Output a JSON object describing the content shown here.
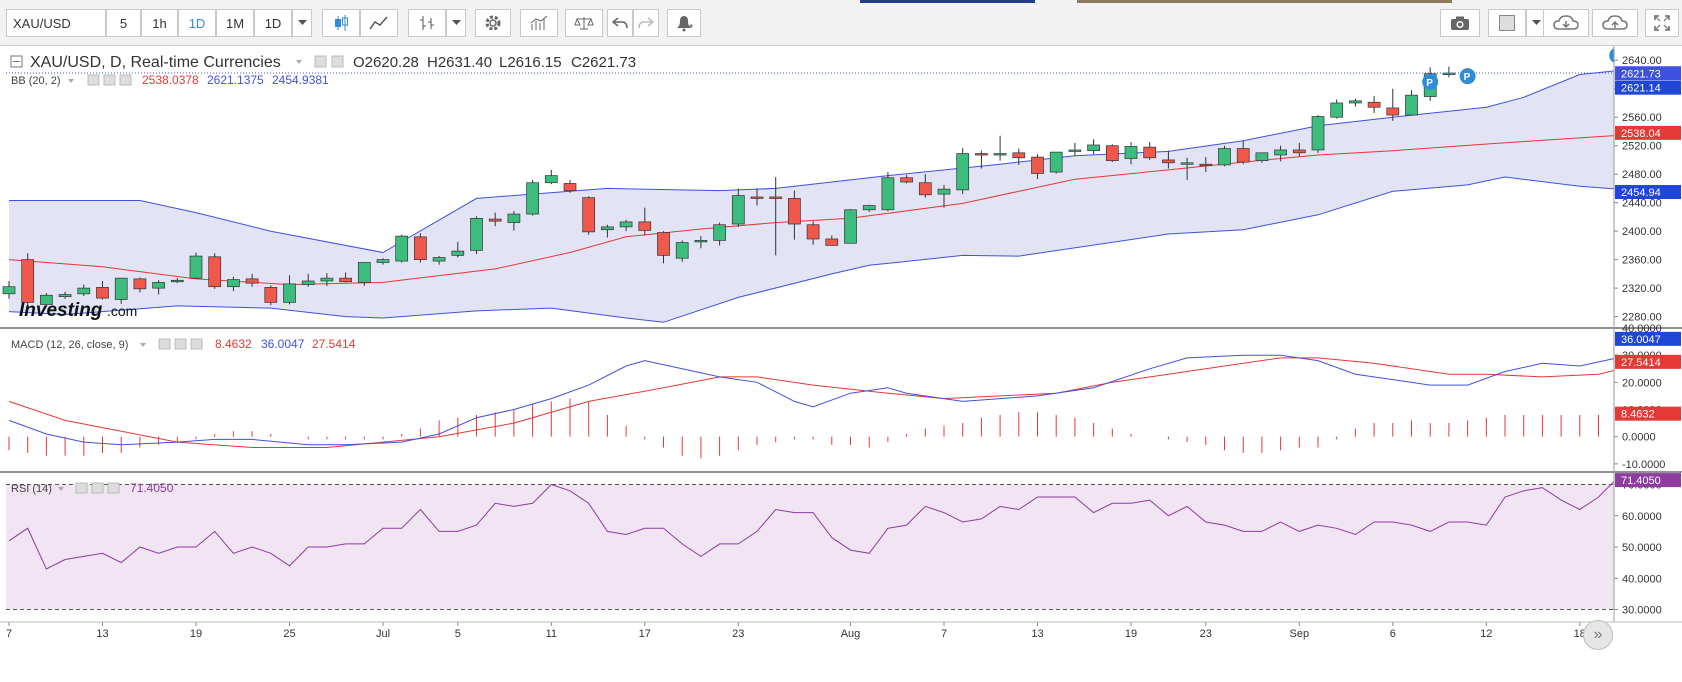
{
  "toolbar": {
    "symbol": "XAU/USD",
    "intervals": [
      "5",
      "1h",
      "1D",
      "1M",
      "1D"
    ],
    "active_interval_index": 2
  },
  "colors": {
    "up": "#3dbd7d",
    "down": "#f0584b",
    "bb_band": "#3f51e0",
    "bb_basis": "#e53935",
    "band_fill": "#e2e3f4",
    "macd_line": "#3f51e0",
    "signal_line": "#e53935",
    "hist": "#e53935",
    "rsi_line": "#8e3ca0",
    "rsi_fill": "#f1e4f3"
  },
  "chart_data": {
    "type": "candlestick",
    "title": "XAU/USD, D, Real-time Currencies",
    "ohlc_labels": {
      "open": "O2620.28",
      "high": "H2631.40",
      "low": "L2616.15",
      "close": "C2621.73"
    },
    "price_axis": {
      "ticks": [
        "2640.00",
        "2600.00",
        "2560.00",
        "2520.00",
        "2480.00",
        "2440.00",
        "2400.00",
        "2360.00",
        "2320.00",
        "2280.00"
      ],
      "ylim": [
        2264,
        2660
      ]
    },
    "price_tags": {
      "last": "2621.73",
      "bb_upper": "2621.14",
      "bb_basis": "2538.04",
      "bb_lower": "2454.94"
    },
    "time_axis": {
      "labels": [
        "7",
        "13",
        "19",
        "25",
        "Jul",
        "5",
        "11",
        "17",
        "23",
        "Aug",
        "7",
        "13",
        "19",
        "23",
        "Sep",
        "6",
        "12",
        "18"
      ],
      "label_bar_index": [
        0,
        5,
        10,
        15,
        20,
        24,
        29,
        34,
        39,
        45,
        50,
        55,
        60,
        64,
        69,
        74,
        79,
        84
      ]
    },
    "candles": [
      [
        2312,
        2330,
        2305,
        2322
      ],
      [
        2360,
        2369,
        2294,
        2300
      ],
      [
        2297,
        2313,
        2295,
        2310
      ],
      [
        2308,
        2315,
        2305,
        2311
      ],
      [
        2312,
        2325,
        2309,
        2320
      ],
      [
        2321,
        2330,
        2304,
        2306
      ],
      [
        2304,
        2332,
        2298,
        2334
      ],
      [
        2333,
        2335,
        2314,
        2319
      ],
      [
        2320,
        2331,
        2311,
        2328
      ],
      [
        2329,
        2334,
        2327,
        2331
      ],
      [
        2334,
        2370,
        2334,
        2365
      ],
      [
        2364,
        2369,
        2319,
        2322
      ],
      [
        2322,
        2336,
        2316,
        2332
      ],
      [
        2333,
        2340,
        2322,
        2327
      ],
      [
        2321,
        2324,
        2296,
        2300
      ],
      [
        2300,
        2338,
        2297,
        2326
      ],
      [
        2325,
        2340,
        2322,
        2330
      ],
      [
        2330,
        2341,
        2323,
        2334
      ],
      [
        2334,
        2342,
        2328,
        2329
      ],
      [
        2328,
        2356,
        2323,
        2356
      ],
      [
        2356,
        2362,
        2353,
        2360
      ],
      [
        2358,
        2395,
        2356,
        2393
      ],
      [
        2392,
        2397,
        2356,
        2360
      ],
      [
        2358,
        2365,
        2353,
        2363
      ],
      [
        2366,
        2385,
        2363,
        2372
      ],
      [
        2373,
        2421,
        2368,
        2418
      ],
      [
        2417,
        2426,
        2407,
        2414
      ],
      [
        2412,
        2428,
        2401,
        2424
      ],
      [
        2424,
        2472,
        2422,
        2468
      ],
      [
        2468,
        2486,
        2466,
        2478
      ],
      [
        2467,
        2472,
        2454,
        2457
      ],
      [
        2447,
        2449,
        2395,
        2399
      ],
      [
        2402,
        2409,
        2391,
        2406
      ],
      [
        2406,
        2416,
        2400,
        2413
      ],
      [
        2413,
        2433,
        2394,
        2401
      ],
      [
        2398,
        2400,
        2355,
        2366
      ],
      [
        2362,
        2387,
        2357,
        2384
      ],
      [
        2385,
        2393,
        2376,
        2387
      ],
      [
        2387,
        2412,
        2380,
        2409
      ],
      [
        2410,
        2460,
        2406,
        2450
      ],
      [
        2448,
        2460,
        2436,
        2446
      ],
      [
        2448,
        2476,
        2366,
        2446
      ],
      [
        2446,
        2457,
        2388,
        2410
      ],
      [
        2409,
        2414,
        2381,
        2389
      ],
      [
        2389,
        2394,
        2380,
        2380
      ],
      [
        2383,
        2431,
        2383,
        2430
      ],
      [
        2430,
        2437,
        2427,
        2436
      ],
      [
        2430,
        2483,
        2428,
        2475
      ],
      [
        2475,
        2479,
        2467,
        2469
      ],
      [
        2468,
        2480,
        2447,
        2451
      ],
      [
        2452,
        2465,
        2433,
        2459
      ],
      [
        2458,
        2517,
        2452,
        2509
      ],
      [
        2509,
        2513,
        2488,
        2507
      ],
      [
        2507,
        2534,
        2499,
        2509
      ],
      [
        2510,
        2516,
        2493,
        2503
      ],
      [
        2504,
        2508,
        2473,
        2481
      ],
      [
        2483,
        2511,
        2481,
        2511
      ],
      [
        2512,
        2524,
        2506,
        2514
      ],
      [
        2513,
        2529,
        2508,
        2521
      ],
      [
        2520,
        2522,
        2497,
        2499
      ],
      [
        2502,
        2525,
        2494,
        2519
      ],
      [
        2518,
        2525,
        2500,
        2503
      ],
      [
        2500,
        2513,
        2488,
        2496
      ],
      [
        2495,
        2503,
        2472,
        2496
      ],
      [
        2494,
        2504,
        2483,
        2492
      ],
      [
        2493,
        2520,
        2491,
        2516
      ],
      [
        2516,
        2527,
        2494,
        2497
      ],
      [
        2499,
        2510,
        2496,
        2510
      ],
      [
        2507,
        2520,
        2498,
        2514
      ],
      [
        2514,
        2524,
        2505,
        2510
      ],
      [
        2514,
        2563,
        2510,
        2561
      ],
      [
        2560,
        2585,
        2558,
        2580
      ],
      [
        2580,
        2586,
        2575,
        2583
      ],
      [
        2581,
        2590,
        2566,
        2574
      ],
      [
        2573,
        2600,
        2555,
        2563
      ],
      [
        2563,
        2598,
        2562,
        2591
      ],
      [
        2589,
        2630,
        2583,
        2621
      ],
      [
        2620,
        2631,
        2616,
        2622
      ]
    ],
    "bb": {
      "label": "BB (20, 2)",
      "values": [
        "2538.0378",
        "2621.1375",
        "2454.9381"
      ],
      "upper": [
        [
          0,
          2443
        ],
        [
          7,
          2443
        ],
        [
          10,
          2426
        ],
        [
          14,
          2400
        ],
        [
          20,
          2370
        ],
        [
          25,
          2446
        ],
        [
          32,
          2460
        ],
        [
          38,
          2457
        ],
        [
          41,
          2460
        ],
        [
          47,
          2478
        ],
        [
          53,
          2494
        ],
        [
          57,
          2506
        ],
        [
          62,
          2512
        ],
        [
          66,
          2527
        ],
        [
          70,
          2548
        ],
        [
          74,
          2560
        ],
        [
          79,
          2574
        ],
        [
          81,
          2588
        ],
        [
          84,
          2620
        ],
        [
          88,
          2631
        ]
      ],
      "basis": [
        [
          0,
          2360
        ],
        [
          5,
          2350
        ],
        [
          10,
          2333
        ],
        [
          15,
          2325
        ],
        [
          20,
          2328
        ],
        [
          26,
          2347
        ],
        [
          30,
          2370
        ],
        [
          33,
          2392
        ],
        [
          37,
          2403
        ],
        [
          41,
          2412
        ],
        [
          45,
          2418
        ],
        [
          51,
          2439
        ],
        [
          57,
          2473
        ],
        [
          62,
          2486
        ],
        [
          66,
          2497
        ],
        [
          70,
          2507
        ],
        [
          74,
          2513
        ],
        [
          80,
          2524
        ],
        [
          84,
          2531
        ],
        [
          88,
          2538
        ]
      ],
      "lower": [
        [
          0,
          2287
        ],
        [
          3,
          2283
        ],
        [
          9,
          2295
        ],
        [
          14,
          2292
        ],
        [
          18,
          2280
        ],
        [
          20,
          2278
        ],
        [
          25,
          2288
        ],
        [
          29,
          2292
        ],
        [
          33,
          2278
        ],
        [
          35,
          2272
        ],
        [
          39,
          2307
        ],
        [
          44,
          2340
        ],
        [
          46,
          2352
        ],
        [
          51,
          2366
        ],
        [
          54,
          2365
        ],
        [
          62,
          2396
        ],
        [
          66,
          2402
        ],
        [
          70,
          2423
        ],
        [
          74,
          2456
        ],
        [
          78,
          2465
        ],
        [
          80,
          2476
        ],
        [
          84,
          2463
        ],
        [
          88,
          2455
        ]
      ]
    },
    "macd": {
      "label": "MACD (12, 26, close, 9)",
      "values": [
        "8.4632",
        "36.0047",
        "27.5414"
      ],
      "axis_ticks": [
        "40.0000",
        "30.0000",
        "20.0000",
        "10.0000",
        "0.0000",
        "-10.0000"
      ],
      "ylim": [
        -13,
        40
      ],
      "line": [
        [
          0,
          6
        ],
        [
          2,
          1
        ],
        [
          4,
          -2
        ],
        [
          6,
          -3
        ],
        [
          9,
          -2
        ],
        [
          11,
          -1
        ],
        [
          13,
          -1
        ],
        [
          16,
          -3
        ],
        [
          18,
          -3
        ],
        [
          21,
          -2
        ],
        [
          23,
          1
        ],
        [
          25,
          7
        ],
        [
          27,
          10
        ],
        [
          29,
          14
        ],
        [
          31,
          19
        ],
        [
          33,
          26
        ],
        [
          34,
          28
        ],
        [
          36,
          25
        ],
        [
          38,
          22
        ],
        [
          40,
          20
        ],
        [
          42,
          13
        ],
        [
          43,
          11
        ],
        [
          45,
          16
        ],
        [
          47,
          18
        ],
        [
          48,
          16
        ],
        [
          51,
          13
        ],
        [
          55,
          15
        ],
        [
          58,
          18
        ],
        [
          61,
          25
        ],
        [
          63,
          29
        ],
        [
          66,
          30
        ],
        [
          68,
          30
        ],
        [
          70,
          28
        ],
        [
          72,
          23
        ],
        [
          74,
          21
        ],
        [
          76,
          19
        ],
        [
          78,
          19
        ],
        [
          80,
          24
        ],
        [
          82,
          27
        ],
        [
          84,
          26
        ],
        [
          86,
          29
        ],
        [
          88,
          35
        ]
      ],
      "signal": [
        [
          0,
          13
        ],
        [
          3,
          6
        ],
        [
          6,
          2
        ],
        [
          9,
          -2
        ],
        [
          13,
          -4
        ],
        [
          17,
          -4
        ],
        [
          20,
          -2
        ],
        [
          23,
          0
        ],
        [
          27,
          5
        ],
        [
          31,
          13
        ],
        [
          35,
          18
        ],
        [
          38,
          22
        ],
        [
          40,
          22
        ],
        [
          43,
          19
        ],
        [
          47,
          16
        ],
        [
          50,
          14
        ],
        [
          53,
          15
        ],
        [
          56,
          16
        ],
        [
          59,
          20
        ],
        [
          62,
          23
        ],
        [
          65,
          26
        ],
        [
          68,
          29
        ],
        [
          70,
          29
        ],
        [
          73,
          27
        ],
        [
          75,
          25
        ],
        [
          77,
          23
        ],
        [
          79,
          23
        ],
        [
          82,
          22
        ],
        [
          85,
          23
        ],
        [
          88,
          28
        ]
      ],
      "hist": [
        -5,
        -6,
        -7,
        -7,
        -7,
        -6,
        -6,
        -4,
        -3,
        -2,
        -1,
        1,
        2,
        2,
        1,
        0,
        -1,
        -1,
        -1,
        -1,
        -1,
        1,
        3,
        6,
        7,
        8,
        9,
        10,
        12,
        13,
        14,
        13,
        8,
        4,
        -1,
        -4,
        -7,
        -8,
        -7,
        -5,
        -3,
        -2,
        -1,
        -1,
        -3,
        -3,
        -4,
        -2,
        1,
        3,
        4,
        5,
        7,
        8,
        9,
        9,
        8,
        7,
        5,
        3,
        1,
        0,
        -1,
        -2,
        -3,
        -5,
        -6,
        -6,
        -5,
        -4,
        -4,
        -1,
        3,
        5,
        5,
        6,
        5,
        5,
        6,
        7,
        8,
        8,
        8,
        8,
        8,
        8,
        8,
        8,
        8
      ]
    },
    "rsi": {
      "label": "RSI (14)",
      "value": "71.4050",
      "axis_ticks": [
        "70.0000",
        "60.0000",
        "50.0000",
        "40.0000",
        "30.0000"
      ],
      "ylim": [
        26,
        74
      ],
      "levels": [
        70,
        30
      ],
      "line": [
        52,
        56,
        43,
        46,
        47,
        48,
        45,
        50,
        48,
        50,
        50,
        55,
        48,
        50,
        48,
        44,
        50,
        50,
        51,
        51,
        56,
        56,
        62,
        55,
        55,
        57,
        64,
        63,
        64,
        70,
        68,
        64,
        55,
        54,
        56,
        56,
        51,
        47,
        51,
        51,
        55,
        62,
        61,
        61,
        53,
        49,
        48,
        56,
        57,
        63,
        61,
        58,
        59,
        63,
        62,
        66,
        66,
        66,
        61,
        64,
        64,
        65,
        60,
        63,
        58,
        57,
        55,
        55,
        58,
        55,
        57,
        56,
        54,
        58,
        58,
        57,
        55,
        58,
        58,
        57,
        66,
        68,
        69,
        65,
        62,
        66,
        72,
        71
      ]
    }
  }
}
